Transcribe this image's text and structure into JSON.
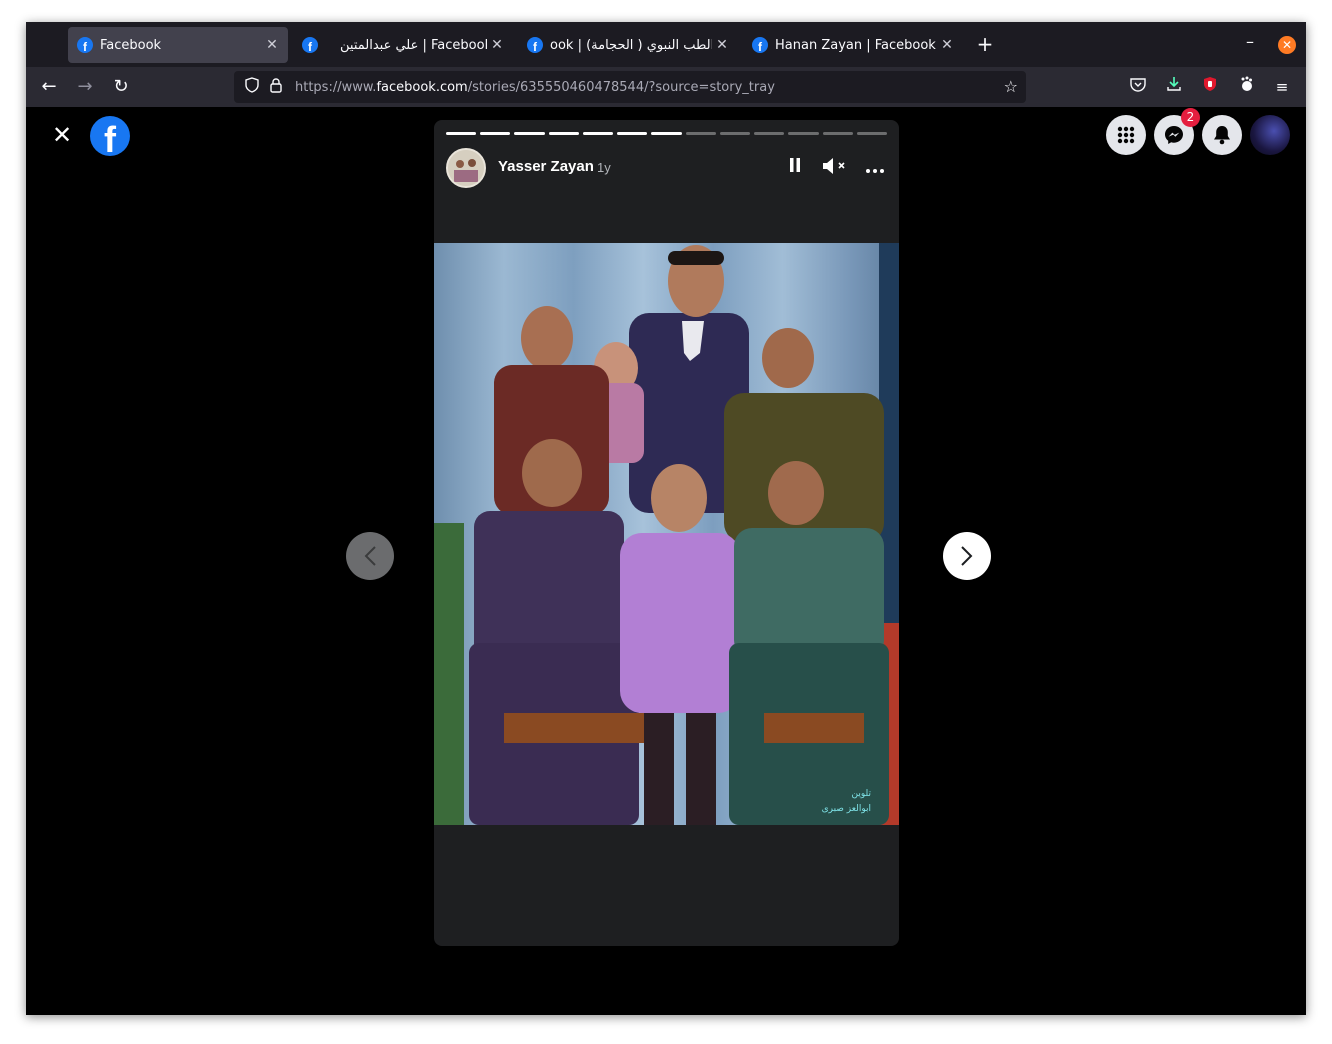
{
  "browser": {
    "tabs": [
      {
        "title": "Facebook",
        "active": true
      },
      {
        "title": "علي عبدالمتين | Facebook",
        "active": false
      },
      {
        "title": "ook | (الحجامة ) الطب النبوي",
        "active": false
      },
      {
        "title": "Hanan Zayan | Facebook",
        "active": false
      }
    ],
    "url_prefix": "https://www.",
    "url_host": "facebook.com",
    "url_path": "/stories/635550460478544/?source=story_tray"
  },
  "story": {
    "author": "Yasser Zayan",
    "time": "1y",
    "segments_total": 13,
    "segments_done": 7,
    "watermark_line1": "تلوين",
    "watermark_line2": "ابوالعز صبرى"
  },
  "header": {
    "messenger_badge": "2"
  },
  "colors": {
    "facebook_blue": "#1877f2",
    "badge_red": "#e41e3f",
    "window_close_orange": "#ff7b24"
  },
  "icons": [
    "close-icon",
    "facebook-logo",
    "menu-grid-icon",
    "messenger-icon",
    "notifications-bell-icon",
    "pause-icon",
    "muted-speaker-icon",
    "more-icon",
    "chevron-left-icon",
    "chevron-right-icon"
  ]
}
